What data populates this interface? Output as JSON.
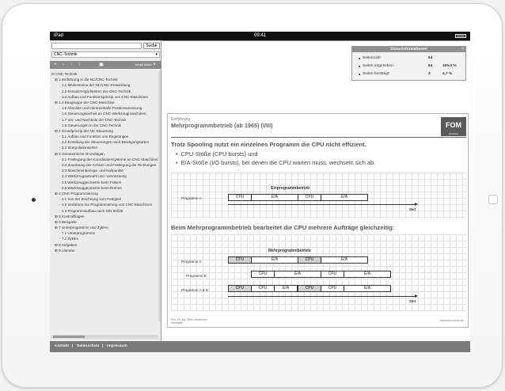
{
  "status_bar": {
    "carrier": "iPad",
    "time": "09:41"
  },
  "sidebar": {
    "search_button": "Suche",
    "selected_view": "CNC-Technik",
    "tool_text": "Inhalt Index",
    "tree": [
      {
        "level": 0,
        "label": "CNC-Technik"
      },
      {
        "level": 1,
        "label": "1 Einführung in die NC/CNC-Technik"
      },
      {
        "level": 2,
        "label": "1.1 Meilensteine der NC/CNC-Entwicklung"
      },
      {
        "level": 2,
        "label": "1.2 Einsatzmöglichkeiten der CNC-Technik"
      },
      {
        "level": 2,
        "label": "1.3 Aufbau und Funktionsprinzip von CNC-Maschinen"
      },
      {
        "level": 1,
        "label": "1.4 Baugruppe der CNC-Maschine"
      },
      {
        "level": 2,
        "label": "1.5 Absolute und inkrementelle Positionsmessung"
      },
      {
        "level": 2,
        "label": "1.6 Steuerungseinheit an CNC-Werkzeugmaschinen"
      },
      {
        "level": 2,
        "label": "1.7 Vor- und Nachteile der CNC-Technik"
      },
      {
        "level": 2,
        "label": "1.8 Steuerungen in der CNC-Technik"
      },
      {
        "level": 1,
        "label": "2 Grundprinzip der NC-Steuerung"
      },
      {
        "level": 2,
        "label": "2.1 Aufbau und Funktion von Regelungen"
      },
      {
        "level": 2,
        "label": "2.2 Einteilung der Steuerungen nach Bewegungsarten"
      },
      {
        "level": 2,
        "label": "2.3 Interpolationsarten"
      },
      {
        "level": 1,
        "label": "3 Geometrische Grundlagen"
      },
      {
        "level": 2,
        "label": "3.1 Festlegung der Koordinatensysteme an CNC-Maschinen"
      },
      {
        "level": 2,
        "label": "3.2 Zuordnung der Achsen und Festlegung der Richtungen"
      },
      {
        "level": 2,
        "label": "3.3 Maschinenbezugs- und Nullpunkte"
      },
      {
        "level": 2,
        "label": "3.4 Werkzeugauswahl und -vermessung"
      },
      {
        "level": 2,
        "label": "3.5 Werkzeuggeometrie beim Fräsen"
      },
      {
        "level": 2,
        "label": "3.6 Werkzeuggeometrie beim Drehen"
      },
      {
        "level": 1,
        "label": "4 CNC-Programmierung"
      },
      {
        "level": 2,
        "label": "4.1 Von der Zeichnung zum Fertigteil"
      },
      {
        "level": 2,
        "label": "4.2 Verfahren zur Programmierung von CNC-Maschinen"
      },
      {
        "level": 2,
        "label": "4.3 Programmaufbau nach DIN 66025"
      },
      {
        "level": 1,
        "label": "5 Kontrollfragen"
      },
      {
        "level": 1,
        "label": "6 Beispiele"
      },
      {
        "level": 1,
        "label": "7 Unterprogramme und Zyklen"
      },
      {
        "level": 2,
        "label": "7.1 Unterprogramme"
      },
      {
        "level": 2,
        "label": "7.2 Zyklen"
      },
      {
        "level": 1,
        "label": "8 Aufgaben"
      },
      {
        "level": 1,
        "label": "9 Literatur"
      }
    ]
  },
  "bottom_bar": {
    "links": [
      "Kontakt",
      "Datenschutz",
      "Impressum"
    ]
  },
  "stats": {
    "title": "Statusinformationen",
    "rows": [
      {
        "label": "Seitenzahl:",
        "value": "64",
        "percent": ""
      },
      {
        "label": "Seiten angesehen:",
        "value": "64",
        "percent": "100,0 %"
      },
      {
        "label": "Seiten bestätigt:",
        "value": "3",
        "percent": "4,7 %"
      }
    ]
  },
  "slide": {
    "supertitle": "Einführung",
    "title": "Mehrprogrammbetrieb (ab 1965) (I/III)",
    "logo": "FOM",
    "logo_sub": "Hochschule",
    "line1": "Trotz Spooling nutzt ein einzelnes Programm die CPU nicht effizient.",
    "bullets": [
      "CPU-Stöße (CPU bursts) und",
      "E/A-Stöße (I/O bursts), bei denen die CPU warten muss, wechseln sich ab."
    ],
    "diagram1": {
      "title": "Einprogrammbetrieb",
      "label": "Programm A",
      "segments": [
        "CPU",
        "E/A",
        "CPU",
        "E/A"
      ],
      "axis": "Zeit"
    },
    "mid_text": "Beim Mehrprogrammbetrieb bearbeitet die CPU mehrere Aufträge gleichzeitig:",
    "diagram2": {
      "title": "Mehrprogrammbetrieb",
      "rows": [
        {
          "label": "Programm A",
          "segments": [
            "CPU",
            "E/A",
            "CPU",
            "E/A"
          ]
        },
        {
          "label": "Programm B",
          "segments": [
            "CPU",
            "E/A",
            "CPU",
            "E/A"
          ]
        },
        {
          "label": "Programm A & B",
          "segments": [
            "CPU",
            "CPU",
            "E/A",
            "CPU",
            "CPU",
            "E/A"
          ]
        }
      ],
      "axis": "Zeit"
    },
    "footer_left": [
      "Prof. Dr.-Ing. Peter Mühlmeyer",
      "Informatik"
    ],
    "footer_right": "www.fom-online.de"
  }
}
